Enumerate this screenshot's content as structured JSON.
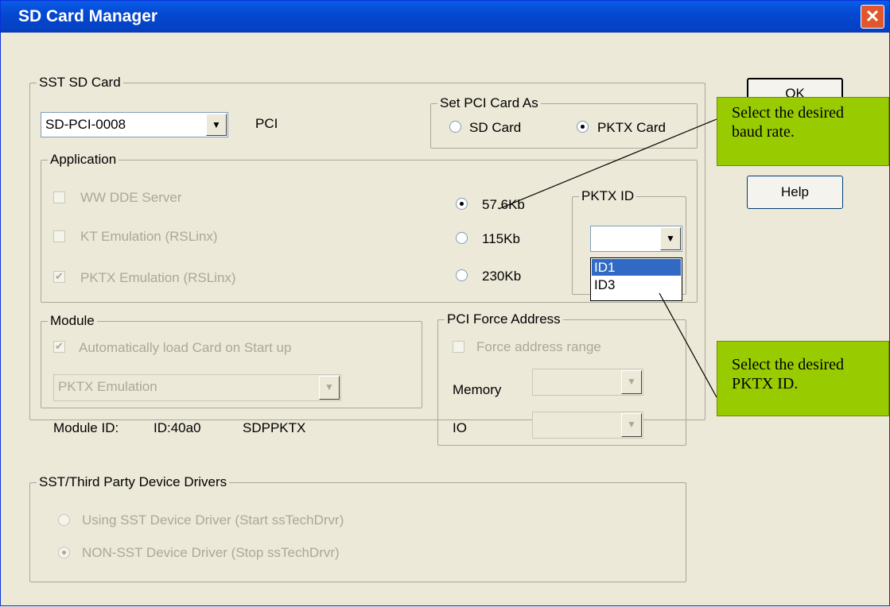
{
  "window": {
    "title": "SD Card Manager",
    "close_glyph": "✕"
  },
  "buttons": {
    "ok": "OK",
    "help": "Help"
  },
  "sst_card": {
    "group_label": "SST SD Card",
    "card_select": "SD-PCI-0008",
    "bus_label": "PCI",
    "set_pci": {
      "label": "Set PCI Card As",
      "sd_card": "SD Card",
      "pktx_card": "PKTX Card",
      "selected": "PKTX Card"
    },
    "application": {
      "label": "Application",
      "ww_dde": "WW DDE Server",
      "kt_emulation": "KT Emulation (RSLinx)",
      "pktx_emulation": "PKTX Emulation (RSLinx)",
      "baud_rates": [
        "57.6Kb",
        "115Kb",
        "230Kb"
      ],
      "baud_selected": "57.6Kb",
      "pktx_id": {
        "label": "PKTX ID",
        "value": "",
        "options": [
          "ID1",
          "ID3"
        ],
        "highlighted": "ID1"
      }
    },
    "module": {
      "label": "Module",
      "auto_load": "Automatically load Card on Start up",
      "emulation": "PKTX Emulation",
      "module_id_label": "Module ID:",
      "module_id": "ID:40a0",
      "module_name": "SDPPKTX"
    },
    "pci_force": {
      "label": "PCI Force Address",
      "force_range": "Force address range",
      "memory_label": "Memory",
      "io_label": "IO"
    }
  },
  "drivers": {
    "label": "SST/Third Party Device Drivers",
    "sst_driver": "Using SST Device Driver (Start ssTechDrvr)",
    "non_sst_driver": "NON-SST Device Driver (Stop ssTechDrvr)",
    "selected": "NON-SST Device Driver (Stop ssTechDrvr)"
  },
  "callouts": {
    "baud": {
      "line1": "Select the desired",
      "line2": "baud rate."
    },
    "pktx": {
      "line1": "Select the desired",
      "line2": "PKTX ID."
    }
  },
  "colors": {
    "titlebar": "#0548d1",
    "dialog_bg": "#ece9d8",
    "callout": "#99cc00",
    "selection": "#316ac5",
    "close": "#e2562c"
  }
}
